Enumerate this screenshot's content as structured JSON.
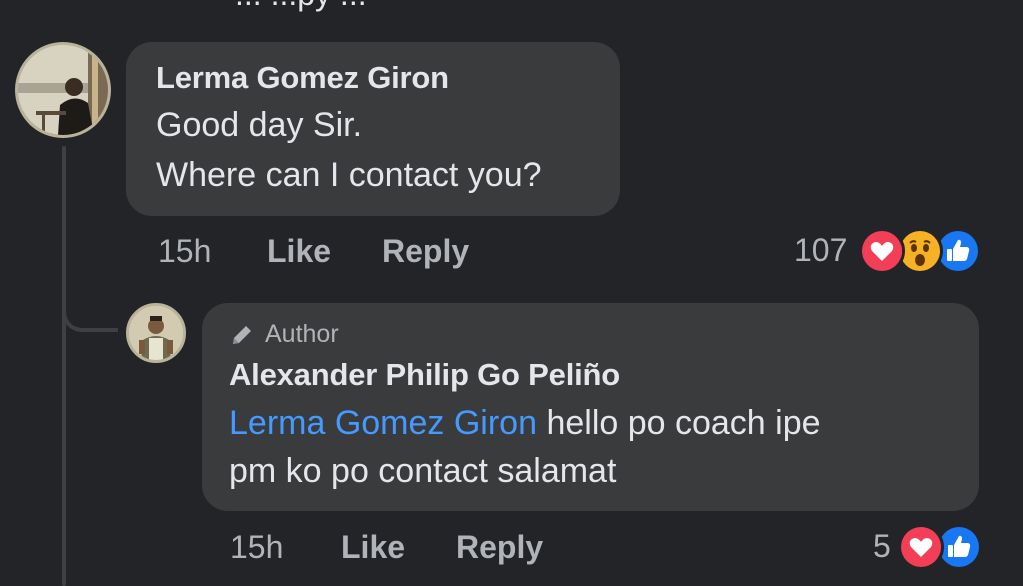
{
  "top_partial_text": "... ...py ...",
  "comment": {
    "author": "Lerma Gomez Giron",
    "lines": [
      "Good day Sir.",
      "Where can I contact you?"
    ],
    "time": "15h",
    "like_label": "Like",
    "reply_label": "Reply",
    "reaction_count": "107",
    "reactions": [
      "love",
      "wow",
      "like"
    ]
  },
  "reply": {
    "badge": "Author",
    "author": "Alexander Philip Go Peliño",
    "mention": "Lerma Gomez Giron",
    "line1_text": " hello po coach ipe",
    "line2": "pm ko po contact salamat",
    "time": "15h",
    "like_label": "Like",
    "reply_label": "Reply",
    "reaction_count": "5",
    "reactions": [
      "love",
      "like"
    ]
  },
  "colors": {
    "background": "#232427",
    "bubble": "#3a3b3c",
    "text": "#e4e6eb",
    "secondary_text": "#b0b3b8",
    "mention": "#4599ff",
    "love": "#f33e58",
    "like": "#1877f2",
    "wow": "#f7b125"
  }
}
